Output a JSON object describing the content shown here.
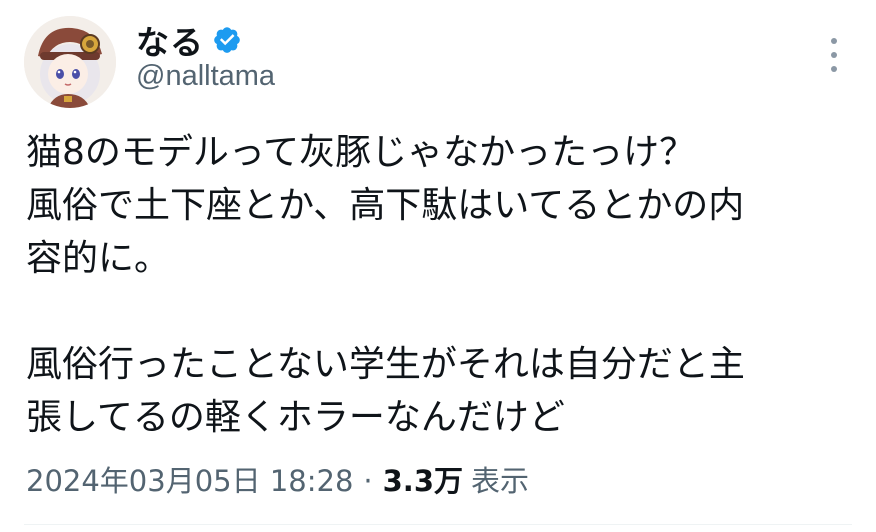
{
  "author": {
    "display_name": "なる",
    "handle": "@nalltama",
    "verified": true,
    "verified_color": "#1d9bf0"
  },
  "tweet": {
    "text": "猫8のモデルって灰豚じゃなかったっけ？\n風俗で土下座とか、高下駄はいてるとかの内\n容的に。\n\n風俗行ったことない学生がそれは自分だと主\n張してるの軽くホラーなんだけど"
  },
  "meta": {
    "timestamp": "2024年03月05日 18:28",
    "separator": "·",
    "views_count": "3.3万",
    "views_label": "表示"
  },
  "icons": {
    "more": "more-vertical-icon",
    "verified": "verified-badge-icon"
  }
}
